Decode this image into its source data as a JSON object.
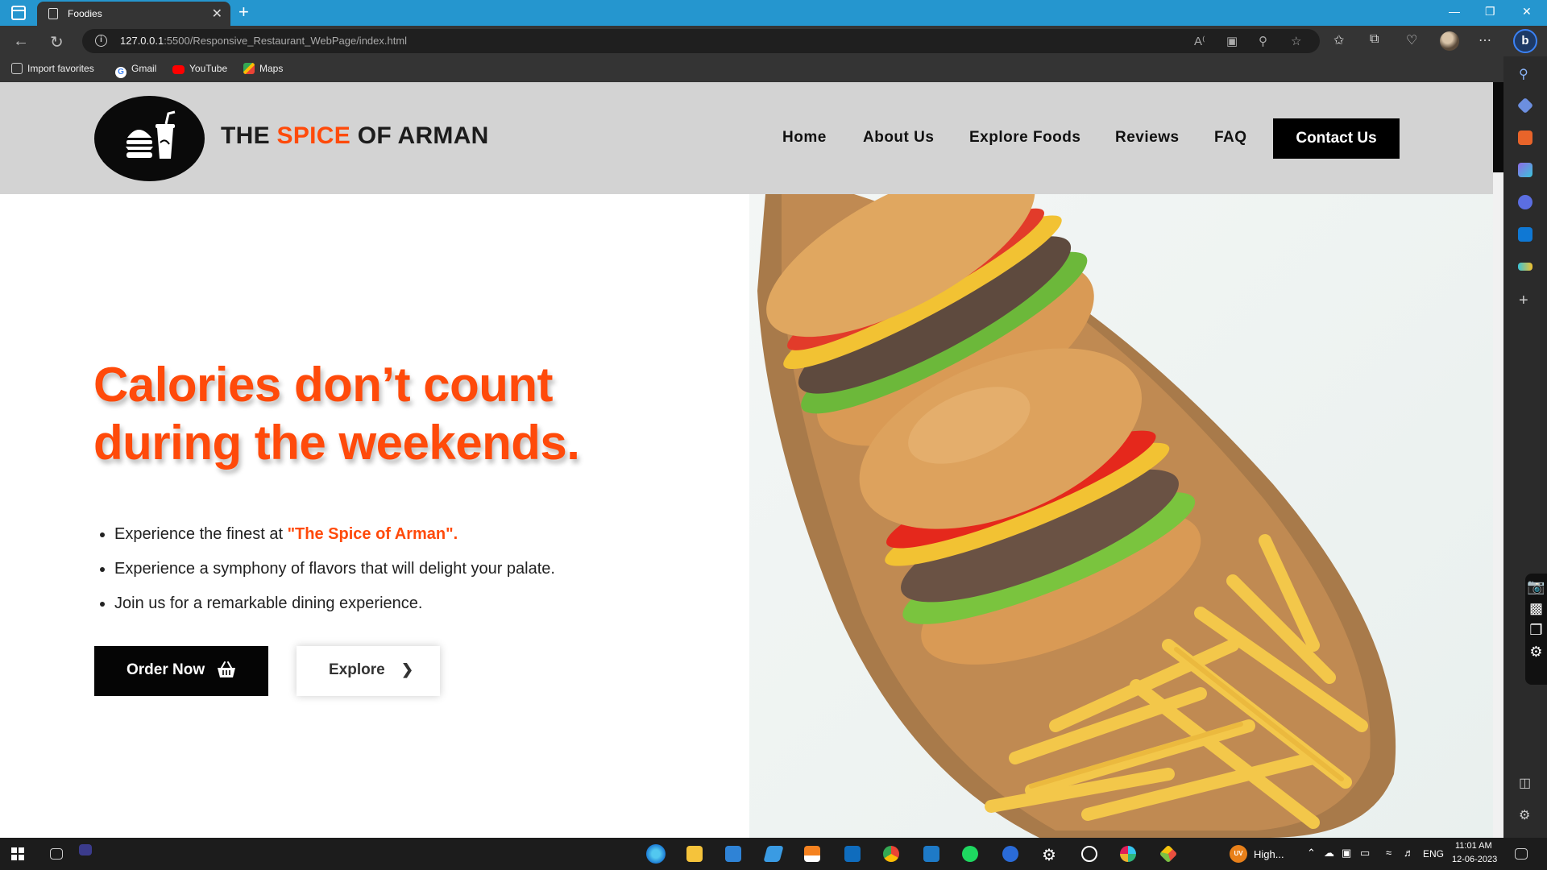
{
  "browser": {
    "tab_title": "Foodies",
    "tab_close": "✕",
    "new_tab": "+",
    "url_host": "127.0.0.1",
    "url_rest": ":5500/Responsive_Restaurant_WebPage/index.html",
    "favorites": [
      {
        "label": "Import favorites"
      },
      {
        "label": "Gmail"
      },
      {
        "label": "YouTube"
      },
      {
        "label": "Maps"
      }
    ]
  },
  "site": {
    "brand_part1": "THE ",
    "brand_accent": "SPICE",
    "brand_part2": " OF ARMAN",
    "nav": [
      "Home",
      "About Us",
      "Explore Foods",
      "Reviews",
      "FAQ"
    ],
    "contact_label": "Contact Us",
    "headline_line1": "Calories don’t count",
    "headline_line2": "during the weekends.",
    "bullet1_prefix": "Experience the finest at ",
    "bullet1_highlight": "\"The Spice of Arman\".",
    "bullet2": "Experience a symphony of flavors that will delight your palate.",
    "bullet3": "Join us for a remarkable dining experience.",
    "order_label": "Order Now",
    "explore_label": "Explore"
  },
  "taskbar": {
    "weather": "High...",
    "weather_badge": "UV",
    "language": "ENG",
    "time": "11:01 AM",
    "date": "12-06-2023"
  },
  "colors": {
    "accent": "#ff4a0a",
    "header_bg": "#d3d3d3",
    "titlebar": "#2596cf"
  }
}
